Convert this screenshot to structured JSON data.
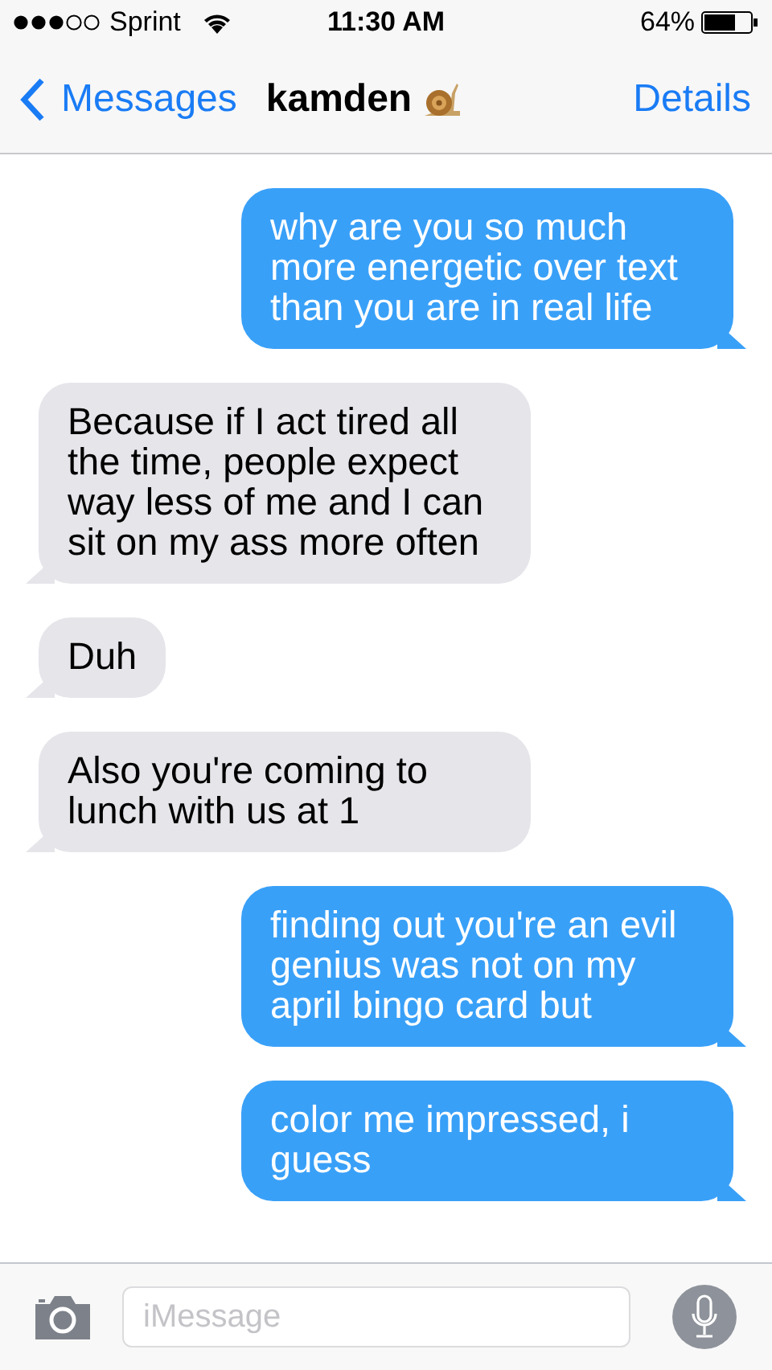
{
  "status_bar": {
    "carrier": "Sprint",
    "time": "11:30 AM",
    "battery": "64%"
  },
  "nav_bar": {
    "back": "Messages",
    "title": "kamden",
    "action": "Details"
  },
  "messages": [
    {
      "kind": "sent",
      "text": "why are you so much more energetic over text than you are in real life"
    },
    {
      "kind": "received",
      "text": "Because if I act tired all the time, people expect way less of me and I can sit on my ass more often"
    },
    {
      "kind": "received",
      "text": "Duh"
    },
    {
      "kind": "received",
      "text": "Also you're coming to lunch with us at 1"
    },
    {
      "kind": "sent",
      "text": "finding out you're an evil genius was not on my april bingo card but"
    },
    {
      "kind": "sent",
      "text": "color me impressed, i guess"
    }
  ],
  "input_bar": {
    "placeholder": "iMessage"
  }
}
